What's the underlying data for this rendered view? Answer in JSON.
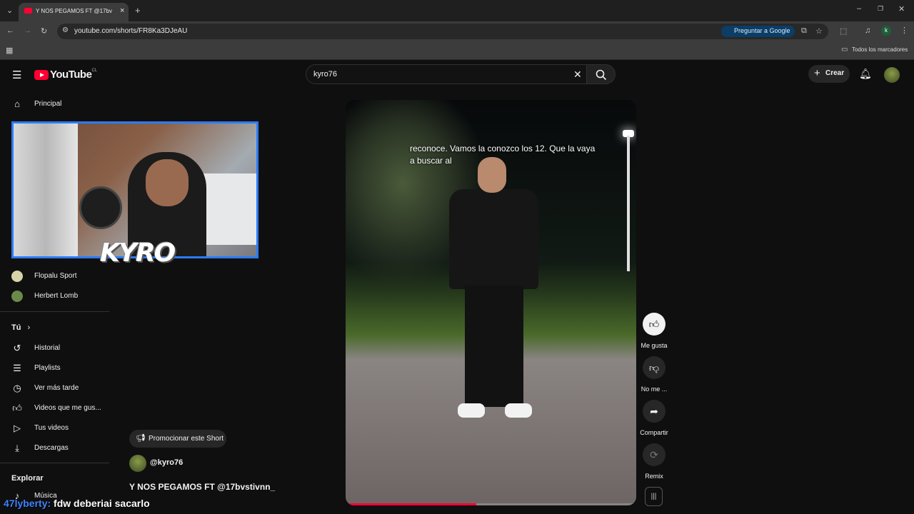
{
  "browser": {
    "tab_title": "Y NOS PEGAMOS FT @17bv",
    "url": "youtube.com/shorts/FR8Ka3DJeAU",
    "ask_google": "Preguntar a Google",
    "all_bookmarks": "Todos los marcadores",
    "profile_initial": "k"
  },
  "masthead": {
    "logo_text": "YouTube",
    "region": "CL",
    "search_value": "kyro76",
    "create_label": "Crear"
  },
  "sidebar": {
    "items_top": [
      {
        "label": "Principal",
        "icon": "home-icon"
      }
    ],
    "subs": [
      {
        "label": "Flopalu Sport"
      },
      {
        "label": "Herbert Lomb"
      }
    ],
    "you_header": "Tú",
    "you_items": [
      {
        "label": "Historial",
        "icon": "history-icon"
      },
      {
        "label": "Playlists",
        "icon": "playlists-icon"
      },
      {
        "label": "Ver más tarde",
        "icon": "watch-later-icon"
      },
      {
        "label": "Videos que me gus...",
        "icon": "liked-icon"
      },
      {
        "label": "Tus videos",
        "icon": "your-videos-icon"
      },
      {
        "label": "Descargas",
        "icon": "downloads-icon"
      }
    ],
    "explore_header": "Explorar",
    "explore_items": [
      {
        "label": "Música",
        "icon": "music-icon"
      }
    ]
  },
  "overlay": {
    "logo": "KYRO",
    "chat_user": "47lyberty:",
    "chat_message": "fdw deberiai sacarlo"
  },
  "short": {
    "caption": "reconoce. Vamos la conozco los 12. Que la vaya a buscar al",
    "progress": 0.45,
    "promote_label": "Promocionar este Short",
    "channel": "@kyro76",
    "title": "Y NOS PEGAMOS FT @17bvstivnn_",
    "actions": [
      {
        "label": "Me gusta",
        "icon": "thumbs-up-icon"
      },
      {
        "label": "No me ...",
        "icon": "thumbs-down-icon"
      },
      {
        "label": "Compartir",
        "icon": "share-icon"
      },
      {
        "label": "Remix",
        "icon": "remix-icon"
      }
    ]
  },
  "colors": {
    "accent": "#ff0033",
    "background": "#0f0f0f",
    "cam_border": "#2b7bff",
    "chat_user": "#3d84ff"
  }
}
